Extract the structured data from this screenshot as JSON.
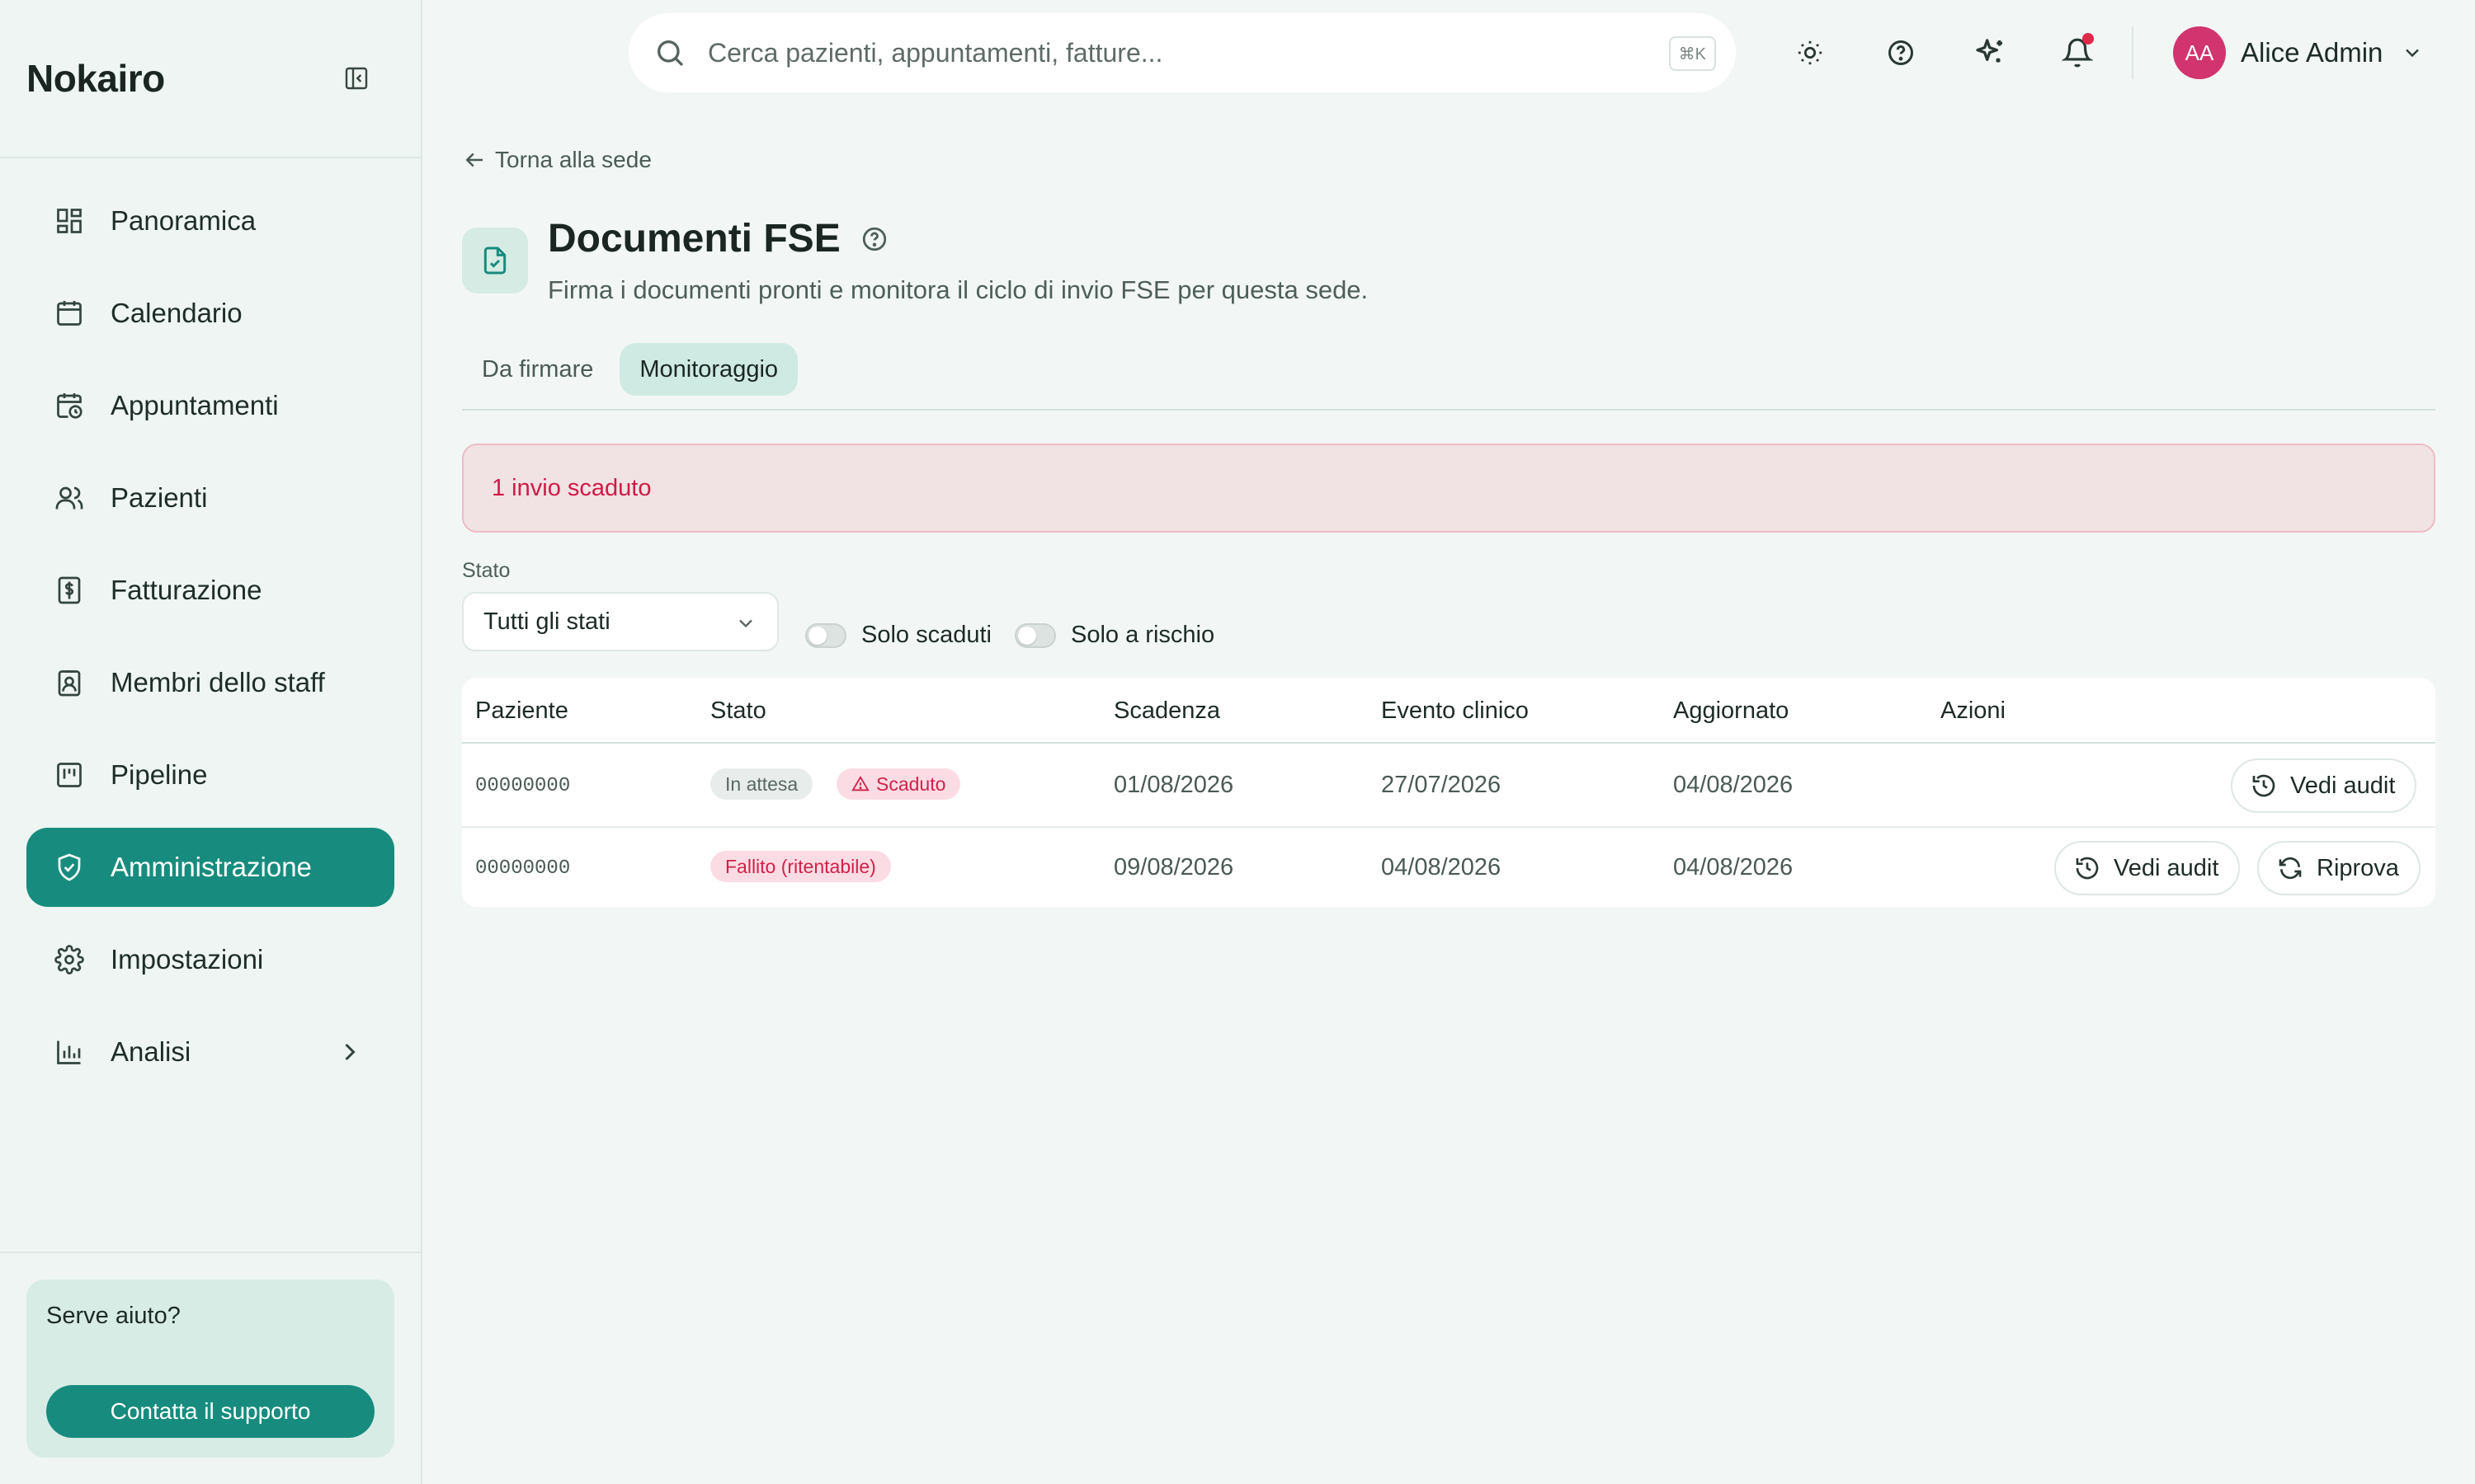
{
  "app": {
    "brand": "Nokairo"
  },
  "sidebar": {
    "items": [
      {
        "label": "Panoramica",
        "icon": "dashboard-icon"
      },
      {
        "label": "Calendario",
        "icon": "calendar-icon"
      },
      {
        "label": "Appuntamenti",
        "icon": "calendar-clock-icon"
      },
      {
        "label": "Pazienti",
        "icon": "users-icon"
      },
      {
        "label": "Fatturazione",
        "icon": "receipt-dollar-icon"
      },
      {
        "label": "Membri dello staff",
        "icon": "id-badge-icon"
      },
      {
        "label": "Pipeline",
        "icon": "kanban-icon"
      },
      {
        "label": "Amministrazione",
        "icon": "shield-check-icon",
        "active": true
      },
      {
        "label": "Impostazioni",
        "icon": "gear-icon"
      },
      {
        "label": "Analisi",
        "icon": "bar-chart-icon"
      }
    ],
    "help": {
      "title": "Serve aiuto?",
      "button": "Contatta il supporto"
    }
  },
  "topbar": {
    "search_placeholder": "Cerca pazienti, appuntamenti, fatture...",
    "shortcut": "⌘K",
    "user": {
      "initials": "AA",
      "name": "Alice Admin"
    }
  },
  "page": {
    "back_label": "Torna alla sede",
    "title": "Documenti FSE",
    "subtitle": "Firma i documenti pronti e monitora il ciclo di invio FSE per questa sede.",
    "tabs": [
      {
        "label": "Da firmare",
        "active": false
      },
      {
        "label": "Monitoraggio",
        "active": true
      }
    ],
    "alert": "1 invio scaduto",
    "filters": {
      "status_label": "Stato",
      "status_value": "Tutti gli stati",
      "toggle_expired": "Solo scaduti",
      "toggle_risk": "Solo a rischio"
    }
  },
  "table": {
    "columns": [
      "Paziente",
      "Stato",
      "Scadenza",
      "Evento clinico",
      "Aggiornato",
      "Azioni"
    ],
    "rows": [
      {
        "patient": "00000000",
        "badges": [
          "In attesa",
          "Scaduto"
        ],
        "deadline": "01/08/2026",
        "event": "27/07/2026",
        "updated": "04/08/2026",
        "actions": [
          "Vedi audit"
        ]
      },
      {
        "patient": "00000000",
        "badges": [
          "Fallito (ritentabile)"
        ],
        "deadline": "09/08/2026",
        "event": "04/08/2026",
        "updated": "04/08/2026",
        "actions": [
          "Vedi audit",
          "Riprova"
        ]
      }
    ]
  },
  "colors": {
    "accent": "#178c7e",
    "danger": "#cf1a45",
    "background": "#f2f7f5",
    "avatar": "#d1346e"
  }
}
